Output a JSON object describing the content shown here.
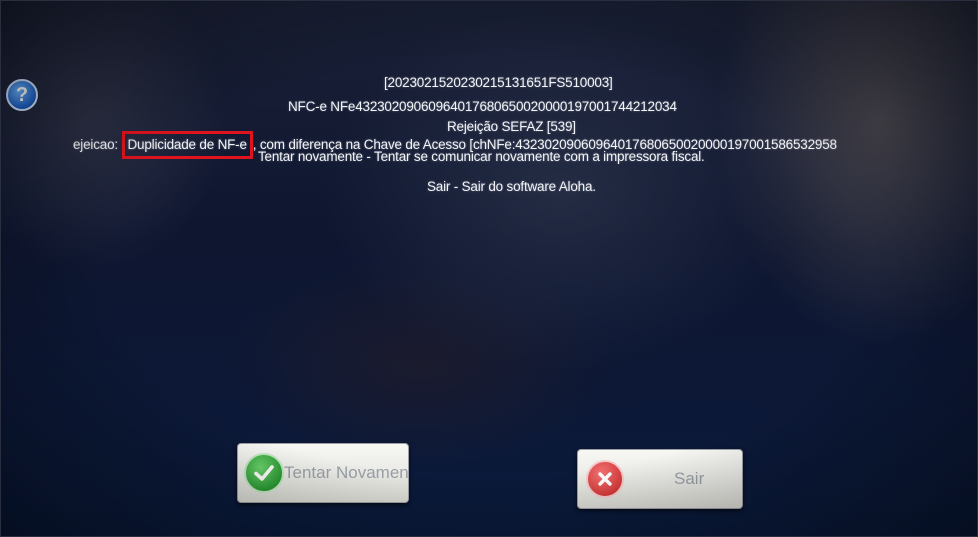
{
  "dialog": {
    "help_icon_glyph": "?",
    "lines": {
      "l1": "[2023021520230215131651FS510003]",
      "l2": "NFC-e NFe43230209060964017680650020000197001744212034",
      "l3": "Rejeição SEFAZ [539]",
      "l4_prefix": "ejeicao:",
      "l4_highlight": "Duplicidade de NF-e",
      "l4_suffix": ", com diferença na Chave de Acesso [chNFe:43230209060964017680650020000197001586532958",
      "l5": "Tentar novamente - Tentar se comunicar novamente com a impressora fiscal.",
      "l6": "Sair - Sair do software Aloha."
    },
    "highlight_color": "#e0141e"
  },
  "buttons": {
    "retry_label": "Tentar Novamen",
    "exit_label": "Sair"
  },
  "icons": {
    "help": "help-icon",
    "retry": "checkmark-icon",
    "exit": "close-icon"
  }
}
